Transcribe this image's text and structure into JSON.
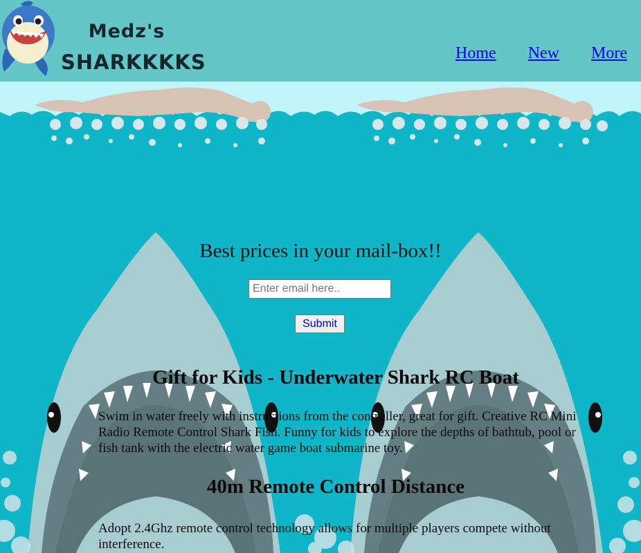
{
  "brand": {
    "line1": "Medz's",
    "line2": "SHARKKKKS",
    "logo_icon": "baby-shark-icon"
  },
  "nav": {
    "items": [
      {
        "label": "Home"
      },
      {
        "label": "New"
      },
      {
        "label": "More"
      }
    ]
  },
  "newsletter": {
    "heading": "Best prices in your mail-box!!",
    "placeholder": "Enter email here..",
    "value": "",
    "submit_label": "Submit"
  },
  "sections": [
    {
      "title": "Gift for Kids - Underwater Shark RC Boat",
      "text": "Swim in water freely with instructions from the controller, great for gift. Creative RC Mini Radio Remote Control Shark Fish. Funny for kids to explore the depths of bathtub, pool or fish tank with the electric water game boat submarine toy."
    },
    {
      "title": "40m Remote Control Distance",
      "text": "Adopt 2.4Ghz remote control technology allows for multiple players compete without interference."
    }
  ],
  "colors": {
    "header_bg": "#65c6c7",
    "water": "#0fb6c8",
    "shark": "#a8cdd0",
    "link": "#0000ee"
  }
}
